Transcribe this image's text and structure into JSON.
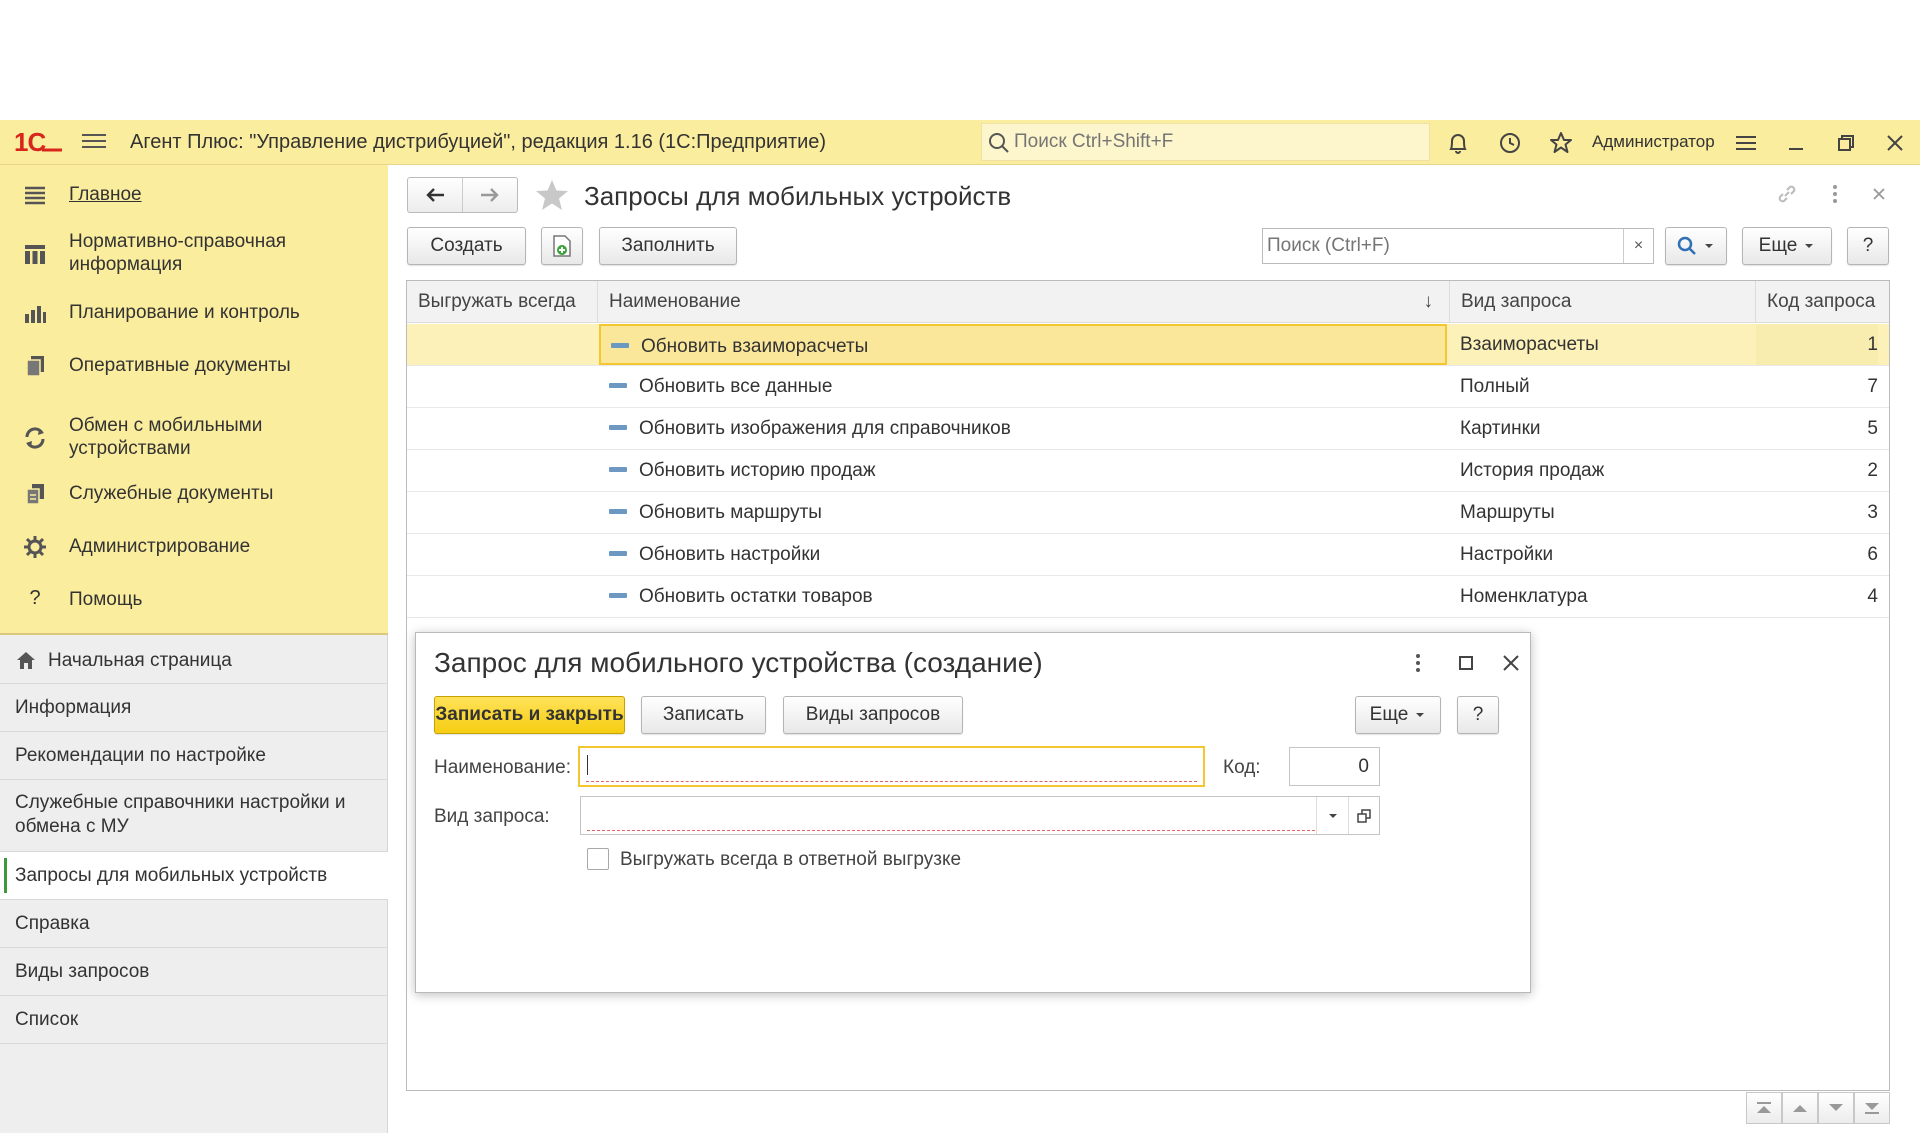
{
  "app": {
    "title": "Агент Плюс: \"Управление дистрибуцией\", редакция 1.16  (1С:Предприятие)",
    "search_placeholder": "Поиск Ctrl+Shift+F",
    "user": "Администратор",
    "logo": "1С"
  },
  "sections": [
    {
      "label": "Главное",
      "icon": "list-icon"
    },
    {
      "label": "Нормативно-справочная информация",
      "icon": "grid-icon"
    },
    {
      "label": "Планирование и контроль",
      "icon": "bar-chart-icon"
    },
    {
      "label": "Оперативные документы",
      "icon": "documents-icon"
    },
    {
      "label": "Обмен с мобильными устройствами",
      "icon": "sync-icon"
    },
    {
      "label": "Служебные документы",
      "icon": "service-documents-icon"
    },
    {
      "label": "Администрирование",
      "icon": "gear-icon"
    },
    {
      "label": "Помощь",
      "icon": "question-icon"
    }
  ],
  "nav": [
    {
      "label": "Начальная страница"
    },
    {
      "label": "Информация"
    },
    {
      "label": "Рекомендации по настройке"
    },
    {
      "label": "Служебные справочники настройки и обмена с МУ"
    },
    {
      "label": "Запросы для мобильных устройств"
    },
    {
      "label": "Справка"
    },
    {
      "label": "Виды запросов"
    },
    {
      "label": "Список"
    }
  ],
  "page": {
    "title": "Запросы для мобильных устройств",
    "toolbar": {
      "create": "Создать",
      "fill": "Заполнить",
      "search_placeholder": "Поиск (Ctrl+F)",
      "clear": "×",
      "more": "Еще",
      "help": "?"
    },
    "columns": [
      "Выгружать всегда",
      "Наименование",
      "Вид запроса",
      "Код запроса"
    ],
    "sort_indicator": "↓",
    "rows": [
      {
        "name": "Обновить взаиморасчеты",
        "type": "Взаиморасчеты",
        "code": "1"
      },
      {
        "name": "Обновить все данные",
        "type": "Полный",
        "code": "7"
      },
      {
        "name": "Обновить изображения для справочников",
        "type": "Картинки",
        "code": "5"
      },
      {
        "name": "Обновить историю продаж",
        "type": "История продаж",
        "code": "2"
      },
      {
        "name": "Обновить маршруты",
        "type": "Маршруты",
        "code": "3"
      },
      {
        "name": "Обновить настройки",
        "type": "Настройки",
        "code": "6"
      },
      {
        "name": "Обновить остатки товаров",
        "type": "Номенклатура",
        "code": "4"
      }
    ],
    "selected_row": 0
  },
  "dialog": {
    "title": "Запрос для мобильного устройства (создание)",
    "save_close": "Записать и закрыть",
    "save": "Записать",
    "request_types": "Виды запросов",
    "more": "Еще",
    "help": "?",
    "name_label": "Наименование:",
    "name_value": "",
    "code_label": "Код:",
    "code_value": "0",
    "type_label": "Вид запроса:",
    "type_value": "",
    "checkbox_label": "Выгружать всегда в ответной выгрузке",
    "checkbox_checked": false
  },
  "colors": {
    "header_bg": "#fbed9e",
    "accent_yellow": "#f5cd12",
    "selection": "#fcf1b8",
    "active_marker": "#3c9a3c",
    "logo_red": "#d8261c"
  }
}
